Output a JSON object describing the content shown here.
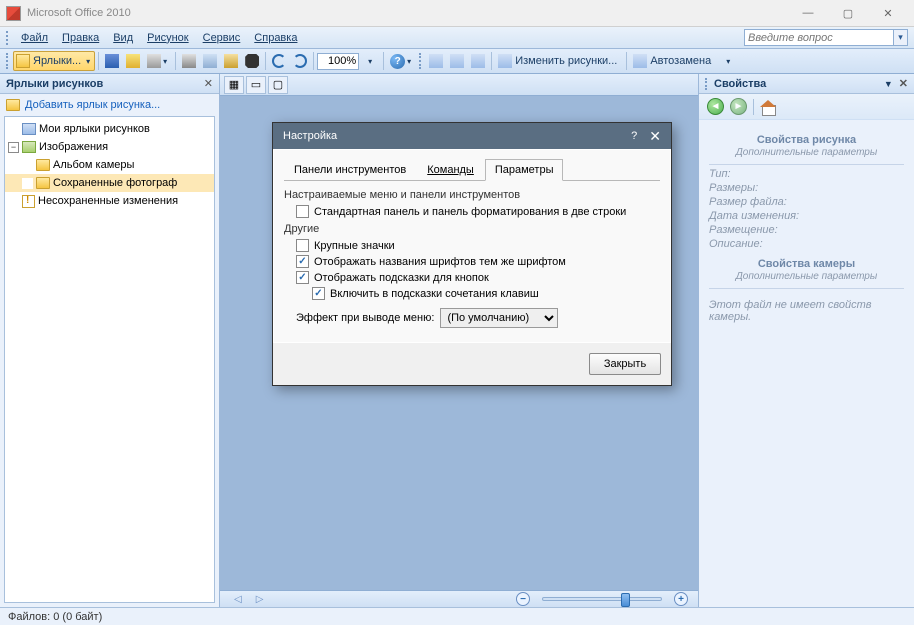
{
  "app": {
    "title": "Microsoft Office 2010"
  },
  "windowControls": {
    "min": "—",
    "max": "▢",
    "close": "✕"
  },
  "menu": {
    "items": [
      "Файл",
      "Правка",
      "Вид",
      "Рисунок",
      "Сервис",
      "Справка"
    ],
    "questionPlaceholder": "Введите вопрос"
  },
  "toolbar": {
    "labelsBtn": "Ярлыки...",
    "zoom": "100%",
    "editPics": "Изменить рисунки...",
    "autoreplace": "Автозамена"
  },
  "leftPane": {
    "title": "Ярлыки рисунков",
    "addLink": "Добавить ярлык рисунка...",
    "items": {
      "myLabels": "Мои ярлыки рисунков",
      "images": "Изображения",
      "camera": "Альбом камеры",
      "saved": "Сохраненные фотограф",
      "unsaved": "Несохраненные изменения"
    }
  },
  "rightPane": {
    "title": "Свойства",
    "sectionPic": "Свойства рисунка",
    "extraLink": "Дополнительные параметры",
    "rows": {
      "type": "Тип:",
      "size": "Размеры:",
      "fileSize": "Размер файла:",
      "date": "Дата изменения:",
      "location": "Размещение:",
      "desc": "Описание:"
    },
    "sectionCam": "Свойства камеры",
    "emptyCam": "Этот файл не имеет свойств камеры."
  },
  "status": {
    "text": "Файлов: 0 (0 байт)"
  },
  "dialog": {
    "title": "Настройка",
    "tabs": {
      "toolbars": "Панели инструментов",
      "commands": "Команды",
      "params": "Параметры"
    },
    "group1": "Настраиваемые меню и панели инструментов",
    "chkTwoRows": "Стандартная панель и панель форматирования в две строки",
    "group2": "Другие",
    "chkLargeIcons": "Крупные значки",
    "chkFontNames": "Отображать названия шрифтов тем же шрифтом",
    "chkTooltips": "Отображать подсказки для кнопок",
    "chkShortcuts": "Включить в подсказки сочетания клавиш",
    "effectLabel": "Эффект при выводе меню:",
    "effectValue": "(По умолчанию)",
    "closeBtn": "Закрыть"
  }
}
